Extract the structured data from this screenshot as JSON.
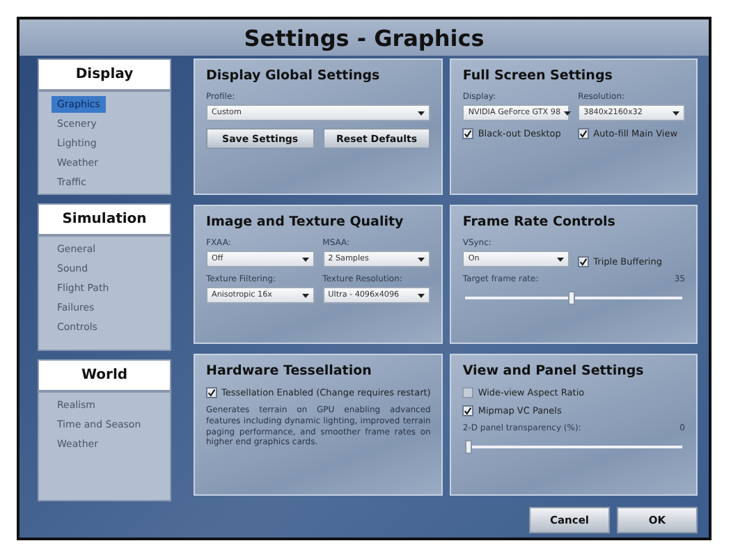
{
  "window": {
    "title": "Settings - Graphics"
  },
  "sidebar": [
    {
      "title": "Display",
      "items": [
        {
          "label": "Graphics",
          "selected": true
        },
        {
          "label": "Scenery",
          "selected": false
        },
        {
          "label": "Lighting",
          "selected": false
        },
        {
          "label": "Weather",
          "selected": false
        },
        {
          "label": "Traffic",
          "selected": false
        }
      ]
    },
    {
      "title": "Simulation",
      "items": [
        {
          "label": "General",
          "selected": false
        },
        {
          "label": "Sound",
          "selected": false
        },
        {
          "label": "Flight Path",
          "selected": false
        },
        {
          "label": "Failures",
          "selected": false
        },
        {
          "label": "Controls",
          "selected": false
        }
      ]
    },
    {
      "title": "World",
      "items": [
        {
          "label": "Realism",
          "selected": false
        },
        {
          "label": "Time and Season",
          "selected": false
        },
        {
          "label": "Weather",
          "selected": false
        }
      ]
    }
  ],
  "panels": [
    {
      "title": "Display Global Settings",
      "rows": [
        [
          {
            "kind": "dropdown",
            "label": "Profile:",
            "value": "Custom"
          }
        ],
        [
          {
            "kind": "button",
            "label": "Save Settings"
          },
          {
            "kind": "button",
            "label": "Reset Defaults"
          }
        ]
      ]
    },
    {
      "title": "Full Screen Settings",
      "rows": [
        [
          {
            "kind": "dropdown",
            "label": "Display:",
            "value": "NVIDIA GeForce GTX 98"
          },
          {
            "kind": "dropdown",
            "label": "Resolution:",
            "value": "3840x2160x32"
          }
        ],
        [
          {
            "kind": "checkbox",
            "label": "Black-out Desktop",
            "checked": true
          },
          {
            "kind": "checkbox",
            "label": "Auto-fill Main View",
            "checked": true
          }
        ]
      ]
    },
    {
      "title": "Image and Texture Quality",
      "rows": [
        [
          {
            "kind": "dropdown",
            "label": "FXAA:",
            "value": "Off"
          },
          {
            "kind": "dropdown",
            "label": "MSAA:",
            "value": "2 Samples"
          }
        ],
        [
          {
            "kind": "dropdown",
            "label": "Texture Filtering:",
            "value": "Anisotropic 16x"
          },
          {
            "kind": "dropdown",
            "label": "Texture Resolution:",
            "value": "Ultra - 4096x4096"
          }
        ]
      ]
    },
    {
      "title": "Frame Rate Controls",
      "rows": [
        [
          {
            "kind": "dropdown",
            "label": "VSync:",
            "value": "On"
          },
          {
            "kind": "checkbox",
            "label": "Triple Buffering",
            "checked": true
          }
        ],
        [
          {
            "kind": "slider",
            "label": "Target frame rate:",
            "reading": "35",
            "level": 0.49
          }
        ]
      ]
    },
    {
      "title": "Hardware Tessellation",
      "rows": [
        [
          {
            "kind": "checkbox",
            "label": "Tessellation Enabled (Change requires restart)",
            "checked": true
          }
        ],
        [
          {
            "kind": "text",
            "text": "Generates terrain on GPU enabling advanced features including dynamic lighting, improved terrain paging performance, and smoother frame rates on higher end graphics cards."
          }
        ]
      ]
    },
    {
      "title": "View and Panel Settings",
      "rows": [
        [
          {
            "kind": "checkbox",
            "label": "Wide-view Aspect Ratio",
            "checked": false
          }
        ],
        [
          {
            "kind": "checkbox",
            "label": "Mipmap VC Panels",
            "checked": true
          }
        ],
        [
          {
            "kind": "slider",
            "label": "2-D panel transparency (%):",
            "reading": "0",
            "level": 0
          }
        ]
      ]
    }
  ],
  "buttons": [
    "Cancel",
    "OK"
  ]
}
